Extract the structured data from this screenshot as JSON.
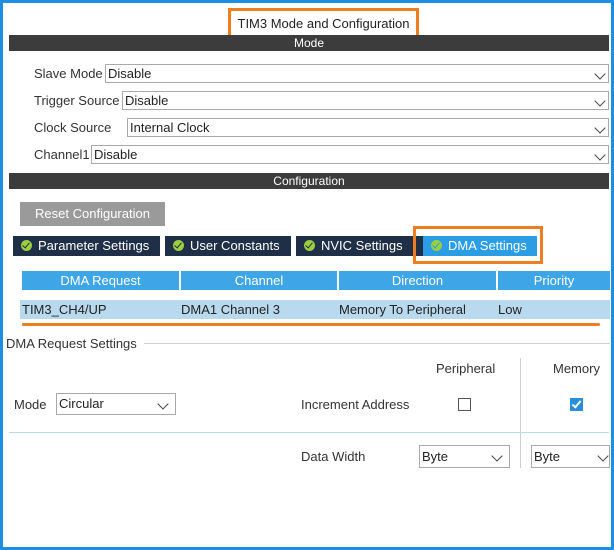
{
  "window": {
    "title": "TIM3 Mode and Configuration"
  },
  "mode_section": {
    "header": "Mode",
    "fields": [
      {
        "label": "Slave Mode",
        "value": "Disable"
      },
      {
        "label": "Trigger Source",
        "value": "Disable"
      },
      {
        "label": "Clock Source",
        "value": "Internal Clock"
      },
      {
        "label": "Channel1",
        "value": "Disable"
      }
    ]
  },
  "config_section": {
    "header": "Configuration",
    "reset_button": "Reset Configuration",
    "tabs": [
      {
        "label": "Parameter Settings",
        "active": false
      },
      {
        "label": "User Constants",
        "active": false
      },
      {
        "label": "NVIC Settings",
        "active": false
      },
      {
        "label": "DMA Settings",
        "active": true
      }
    ]
  },
  "dma_table": {
    "columns": [
      "DMA Request",
      "Channel",
      "Direction",
      "Priority"
    ],
    "rows": [
      [
        "TIM3_CH4/UP",
        "DMA1 Channel 3",
        "Memory To Peripheral",
        "Low"
      ]
    ]
  },
  "dma_request_settings": {
    "group_title": "DMA Request Settings",
    "col_peripheral": "Peripheral",
    "col_memory": "Memory",
    "mode_label": "Mode",
    "mode_value": "Circular",
    "increment_label": "Increment Address",
    "increment_peripheral": false,
    "increment_memory": true,
    "data_width_label": "Data Width",
    "data_width_peripheral": "Byte",
    "data_width_memory": "Byte"
  },
  "colors": {
    "frame_blue": "#1e8fe0",
    "highlight_orange": "#ef7d22",
    "tab_dark": "#1f2f47",
    "tab_active": "#2a9de5",
    "header_blue": "#3ea6e6",
    "row_selected": "#b9d9ef"
  }
}
